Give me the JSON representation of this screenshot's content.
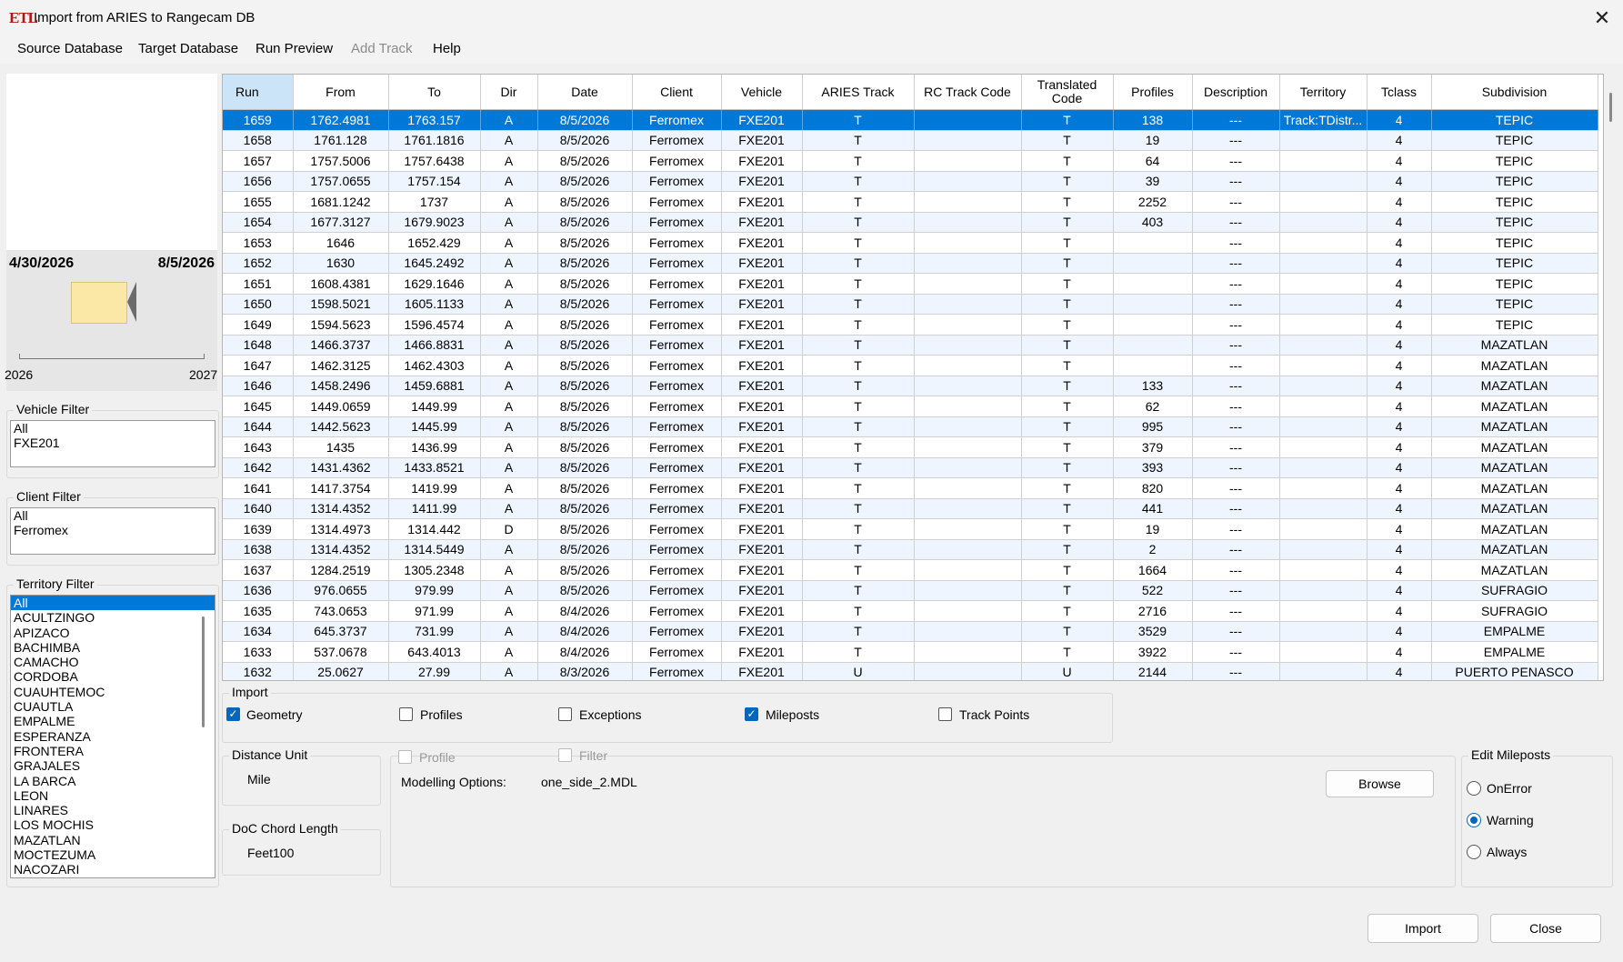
{
  "window": {
    "title": "Import from ARIES to Rangecam DB",
    "icon_text": "ETL",
    "close_glyph": "✕"
  },
  "menu": [
    {
      "label": "Source Database",
      "enabled": true
    },
    {
      "label": "Target Database",
      "enabled": true
    },
    {
      "label": "Run Preview",
      "enabled": true
    },
    {
      "label": "Add Track",
      "enabled": false
    },
    {
      "label": "Help",
      "enabled": true
    }
  ],
  "timeline": {
    "start_date": "4/30/2026",
    "end_date": "8/5/2026",
    "axis_start": "2026",
    "axis_end": "2027"
  },
  "vehicle_filter": {
    "title": "Vehicle Filter",
    "items": [
      "All",
      "FXE201"
    ]
  },
  "client_filter": {
    "title": "Client Filter",
    "items": [
      "All",
      "Ferromex"
    ]
  },
  "territory_filter": {
    "title": "Territory Filter",
    "selected": "All",
    "items": [
      "All",
      "ACULTZINGO",
      "APIZACO",
      "BACHIMBA",
      "CAMACHO",
      "CORDOBA",
      "CUAUHTEMOC",
      "CUAUTLA",
      "EMPALME",
      "ESPERANZA",
      "FRONTERA",
      "GRAJALES",
      "LA BARCA",
      "LEON",
      "LINARES",
      "LOS MOCHIS",
      "MAZATLAN",
      "MOCTEZUMA",
      "NACOZARI"
    ]
  },
  "grid": {
    "columns": [
      "Run",
      "From",
      "To",
      "Dir",
      "Date",
      "Client",
      "Vehicle",
      "ARIES Track",
      "RC Track Code",
      "Translated Code",
      "Profiles",
      "Description",
      "Territory",
      "Tclass",
      "Subdivision"
    ],
    "selected_run": "1659",
    "rows": [
      [
        "1659",
        "1762.4981",
        "1763.157",
        "A",
        "8/5/2026",
        "Ferromex",
        "FXE201",
        "T",
        "",
        "T",
        "138",
        "---",
        "Track:TDistr...",
        "4",
        "TEPIC"
      ],
      [
        "1658",
        "1761.128",
        "1761.1816",
        "A",
        "8/5/2026",
        "Ferromex",
        "FXE201",
        "T",
        "",
        "T",
        "19",
        "---",
        "",
        "4",
        "TEPIC"
      ],
      [
        "1657",
        "1757.5006",
        "1757.6438",
        "A",
        "8/5/2026",
        "Ferromex",
        "FXE201",
        "T",
        "",
        "T",
        "64",
        "---",
        "",
        "4",
        "TEPIC"
      ],
      [
        "1656",
        "1757.0655",
        "1757.154",
        "A",
        "8/5/2026",
        "Ferromex",
        "FXE201",
        "T",
        "",
        "T",
        "39",
        "---",
        "",
        "4",
        "TEPIC"
      ],
      [
        "1655",
        "1681.1242",
        "1737",
        "A",
        "8/5/2026",
        "Ferromex",
        "FXE201",
        "T",
        "",
        "T",
        "2252",
        "---",
        "",
        "4",
        "TEPIC"
      ],
      [
        "1654",
        "1677.3127",
        "1679.9023",
        "A",
        "8/5/2026",
        "Ferromex",
        "FXE201",
        "T",
        "",
        "T",
        "403",
        "---",
        "",
        "4",
        "TEPIC"
      ],
      [
        "1653",
        "1646",
        "1652.429",
        "A",
        "8/5/2026",
        "Ferromex",
        "FXE201",
        "T",
        "",
        "T",
        "",
        "---",
        "",
        "4",
        "TEPIC"
      ],
      [
        "1652",
        "1630",
        "1645.2492",
        "A",
        "8/5/2026",
        "Ferromex",
        "FXE201",
        "T",
        "",
        "T",
        "",
        "---",
        "",
        "4",
        "TEPIC"
      ],
      [
        "1651",
        "1608.4381",
        "1629.1646",
        "A",
        "8/5/2026",
        "Ferromex",
        "FXE201",
        "T",
        "",
        "T",
        "",
        "---",
        "",
        "4",
        "TEPIC"
      ],
      [
        "1650",
        "1598.5021",
        "1605.1133",
        "A",
        "8/5/2026",
        "Ferromex",
        "FXE201",
        "T",
        "",
        "T",
        "",
        "---",
        "",
        "4",
        "TEPIC"
      ],
      [
        "1649",
        "1594.5623",
        "1596.4574",
        "A",
        "8/5/2026",
        "Ferromex",
        "FXE201",
        "T",
        "",
        "T",
        "",
        "---",
        "",
        "4",
        "TEPIC"
      ],
      [
        "1648",
        "1466.3737",
        "1466.8831",
        "A",
        "8/5/2026",
        "Ferromex",
        "FXE201",
        "T",
        "",
        "T",
        "",
        "---",
        "",
        "4",
        "MAZATLAN"
      ],
      [
        "1647",
        "1462.3125",
        "1462.4303",
        "A",
        "8/5/2026",
        "Ferromex",
        "FXE201",
        "T",
        "",
        "T",
        "",
        "---",
        "",
        "4",
        "MAZATLAN"
      ],
      [
        "1646",
        "1458.2496",
        "1459.6881",
        "A",
        "8/5/2026",
        "Ferromex",
        "FXE201",
        "T",
        "",
        "T",
        "133",
        "---",
        "",
        "4",
        "MAZATLAN"
      ],
      [
        "1645",
        "1449.0659",
        "1449.99",
        "A",
        "8/5/2026",
        "Ferromex",
        "FXE201",
        "T",
        "",
        "T",
        "62",
        "---",
        "",
        "4",
        "MAZATLAN"
      ],
      [
        "1644",
        "1442.5623",
        "1445.99",
        "A",
        "8/5/2026",
        "Ferromex",
        "FXE201",
        "T",
        "",
        "T",
        "995",
        "---",
        "",
        "4",
        "MAZATLAN"
      ],
      [
        "1643",
        "1435",
        "1436.99",
        "A",
        "8/5/2026",
        "Ferromex",
        "FXE201",
        "T",
        "",
        "T",
        "379",
        "---",
        "",
        "4",
        "MAZATLAN"
      ],
      [
        "1642",
        "1431.4362",
        "1433.8521",
        "A",
        "8/5/2026",
        "Ferromex",
        "FXE201",
        "T",
        "",
        "T",
        "393",
        "---",
        "",
        "4",
        "MAZATLAN"
      ],
      [
        "1641",
        "1417.3754",
        "1419.99",
        "A",
        "8/5/2026",
        "Ferromex",
        "FXE201",
        "T",
        "",
        "T",
        "820",
        "---",
        "",
        "4",
        "MAZATLAN"
      ],
      [
        "1640",
        "1314.4352",
        "1411.99",
        "A",
        "8/5/2026",
        "Ferromex",
        "FXE201",
        "T",
        "",
        "T",
        "441",
        "---",
        "",
        "4",
        "MAZATLAN"
      ],
      [
        "1639",
        "1314.4973",
        "1314.442",
        "D",
        "8/5/2026",
        "Ferromex",
        "FXE201",
        "T",
        "",
        "T",
        "19",
        "---",
        "",
        "4",
        "MAZATLAN"
      ],
      [
        "1638",
        "1314.4352",
        "1314.5449",
        "A",
        "8/5/2026",
        "Ferromex",
        "FXE201",
        "T",
        "",
        "T",
        "2",
        "---",
        "",
        "4",
        "MAZATLAN"
      ],
      [
        "1637",
        "1284.2519",
        "1305.2348",
        "A",
        "8/5/2026",
        "Ferromex",
        "FXE201",
        "T",
        "",
        "T",
        "1664",
        "---",
        "",
        "4",
        "MAZATLAN"
      ],
      [
        "1636",
        "976.0655",
        "979.99",
        "A",
        "8/5/2026",
        "Ferromex",
        "FXE201",
        "T",
        "",
        "T",
        "522",
        "---",
        "",
        "4",
        "SUFRAGIO"
      ],
      [
        "1635",
        "743.0653",
        "971.99",
        "A",
        "8/4/2026",
        "Ferromex",
        "FXE201",
        "T",
        "",
        "T",
        "2716",
        "---",
        "",
        "4",
        "SUFRAGIO"
      ],
      [
        "1634",
        "645.3737",
        "731.99",
        "A",
        "8/4/2026",
        "Ferromex",
        "FXE201",
        "T",
        "",
        "T",
        "3529",
        "---",
        "",
        "4",
        "EMPALME"
      ],
      [
        "1633",
        "537.0678",
        "643.4013",
        "A",
        "8/4/2026",
        "Ferromex",
        "FXE201",
        "T",
        "",
        "T",
        "3922",
        "---",
        "",
        "4",
        "EMPALME"
      ],
      [
        "1632",
        "25.0627",
        "27.99",
        "A",
        "8/3/2026",
        "Ferromex",
        "FXE201",
        "U",
        "",
        "U",
        "2144",
        "---",
        "",
        "4",
        "PUERTO PENASCO"
      ]
    ]
  },
  "import_group": {
    "title": "Import",
    "options": [
      {
        "label": "Geometry",
        "checked": true
      },
      {
        "label": "Profiles",
        "checked": false
      },
      {
        "label": "Exceptions",
        "checked": false
      },
      {
        "label": "Mileposts",
        "checked": true
      },
      {
        "label": "Track Points",
        "checked": false
      }
    ]
  },
  "distance_unit": {
    "title": "Distance Unit",
    "value": "Mile"
  },
  "doc_chord": {
    "title": "DoC Chord Length",
    "value": "Feet100"
  },
  "modelling": {
    "profile_label": "Profile",
    "filter_label": "Filter",
    "options_label": "Modelling Options:",
    "options_value": "one_side_2.MDL",
    "browse_label": "Browse"
  },
  "edit_mileposts": {
    "title": "Edit Mileposts",
    "selected": "Warning",
    "options": [
      "OnError",
      "Warning",
      "Always"
    ]
  },
  "buttons": {
    "import": "Import",
    "close": "Close"
  },
  "colors": {
    "selection": "#0078d7",
    "alt_row": "#eef5ff",
    "accent": "#0067c0",
    "header_sorted": "#cce4f7"
  }
}
